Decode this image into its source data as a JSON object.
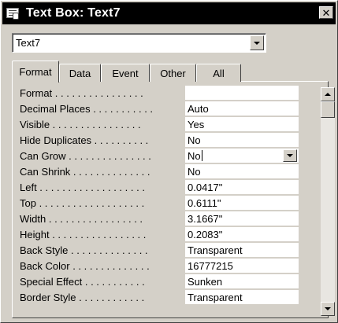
{
  "window": {
    "title": "Text Box: Text7",
    "close_glyph": "✕",
    "icon": "property-sheet-icon"
  },
  "object_selector": {
    "value": "Text7",
    "icon": "chevron-down-icon"
  },
  "tabs": [
    {
      "label": "Format",
      "active": true
    },
    {
      "label": "Data",
      "active": false
    },
    {
      "label": "Event",
      "active": false
    },
    {
      "label": "Other",
      "active": false
    },
    {
      "label": "All",
      "active": false
    }
  ],
  "properties": [
    {
      "label": "Format . . . . . . . . . . . . . . . .",
      "value": ""
    },
    {
      "label": "Decimal Places . . . . . . . . . . .",
      "value": "Auto"
    },
    {
      "label": "Visible . . . . . . . . . . . . . . . .",
      "value": "Yes"
    },
    {
      "label": "Hide Duplicates . . . . . . . . . .",
      "value": "No"
    },
    {
      "label": "Can Grow . . . . . . . . . . . . . . .",
      "value": "No"
    },
    {
      "label": "Can Shrink . . . . . . . . . . . . . .",
      "value": "No"
    },
    {
      "label": "Left . . . . . . . . . . . . . . . . . . .",
      "value": "0.0417\""
    },
    {
      "label": "Top . . . . . . . . . . . . . . . . . . .",
      "value": "0.6111\""
    },
    {
      "label": "Width . . . . . . . . . . . . . . . . .",
      "value": "3.1667\""
    },
    {
      "label": "Height . . . . . . . . . . . . . . . . .",
      "value": "0.2083\""
    },
    {
      "label": "Back Style . . . . . . . . . . . . . .",
      "value": "Transparent"
    },
    {
      "label": "Back Color . . . . . . . . . . . . . .",
      "value": "16777215"
    },
    {
      "label": "Special Effect . . . . . . . . . . .",
      "value": "Sunken"
    },
    {
      "label": "Border Style . . . . . . . . . . . .",
      "value": "Transparent"
    }
  ],
  "active_property_index": 4,
  "colors": {
    "face": "#d4d0c8",
    "titlebar": "#000000",
    "field": "#ffffff"
  }
}
